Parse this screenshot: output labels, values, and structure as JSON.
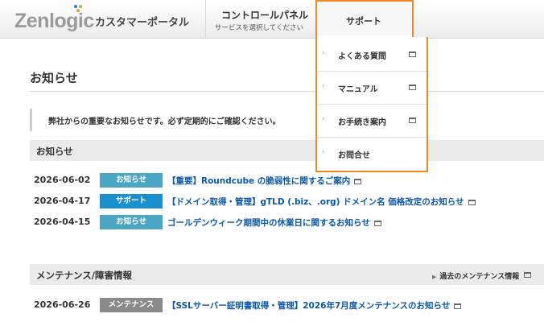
{
  "header": {
    "logo": "Zenlogic",
    "portal": "カスタマーポータル",
    "control_panel": {
      "title": "コントロールパネル",
      "subtitle": "サービスを選択してください"
    },
    "support": {
      "label": "サポート",
      "items": [
        {
          "label": "よくある質問"
        },
        {
          "label": "マニュアル"
        },
        {
          "label": "お手続き案内"
        },
        {
          "label": "お問合せ"
        }
      ]
    }
  },
  "page": {
    "title": "お知らせ",
    "notice": "弊社からの重要なお知らせです。必ず定期的にご確認ください。"
  },
  "sections": [
    {
      "title": "お知らせ",
      "rows": [
        {
          "date": "2026-06-02",
          "badge": "お知らせ",
          "badge_color": "#4aa6c2",
          "title": "【重要】Roundcube の脆弱性に関するご案内"
        },
        {
          "date": "2026-04-17",
          "badge": "サポート",
          "badge_color": "#1a90cf",
          "title": "【ドメイン取得・管理】gTLD (.biz、.org) ドメイン名 価格改定のお知らせ"
        },
        {
          "date": "2026-04-15",
          "badge": "お知らせ",
          "badge_color": "#4aa6c2",
          "title": "ゴールデンウィーク期間中の休業日に関するお知らせ"
        }
      ]
    },
    {
      "title": "メンテナンス/障害情報",
      "link": "過去のメンテナンス情報",
      "rows": [
        {
          "date": "2026-06-26",
          "badge": "メンテナンス",
          "badge_color": "#8a8a8a",
          "title": "【SSLサーバー証明書取得・管理】2026年7月度メンテナンスのお知らせ"
        }
      ]
    }
  ],
  "colors": {
    "accent_border": "#f08a24",
    "link": "#0b57a8"
  }
}
